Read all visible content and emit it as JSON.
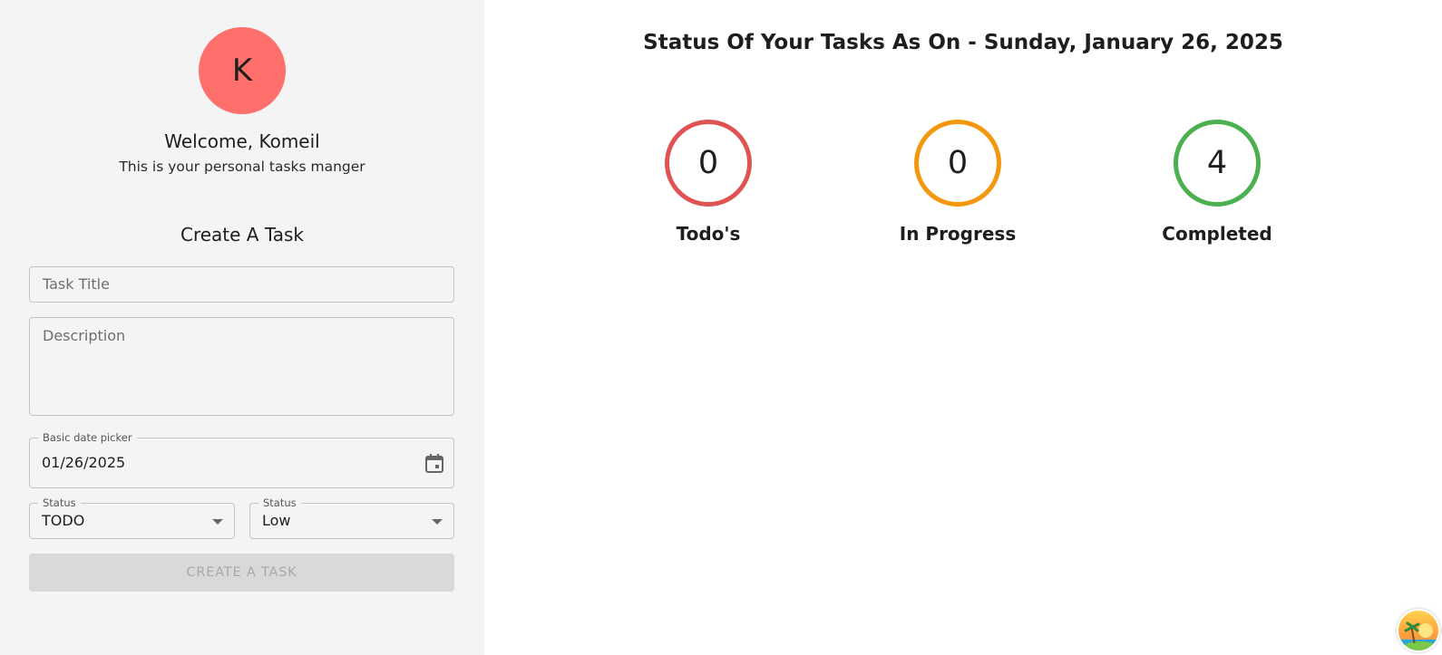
{
  "sidebar": {
    "avatar_initial": "K",
    "welcome": "Welcome, Komeil",
    "subtitle": "This is your personal tasks manger",
    "form": {
      "title": "Create A Task",
      "task_title_placeholder": "Task Title",
      "description_placeholder": "Description",
      "date_label": "Basic date picker",
      "date_value": "01/26/2025",
      "status_label": "Status",
      "status_value": "TODO",
      "priority_label": "Status",
      "priority_value": "Low",
      "submit_label": "CREATE A TASK"
    }
  },
  "main": {
    "title": "Status Of Your Tasks As On - Sunday, January 26, 2025",
    "stats": [
      {
        "count": "0",
        "label": "Todo's",
        "color": "#e05353"
      },
      {
        "count": "0",
        "label": "In Progress",
        "color": "#f5960f"
      },
      {
        "count": "4",
        "label": "Completed",
        "color": "#4caf50"
      }
    ]
  },
  "colors": {
    "avatar_bg": "#ff6f6b",
    "sidebar_bg": "#f4f4f4",
    "button_disabled_bg": "#d9d9d9"
  },
  "icons": {
    "date": "calendar-icon",
    "select": "chevron-down-icon",
    "corner": "beach-sunset-icon"
  }
}
